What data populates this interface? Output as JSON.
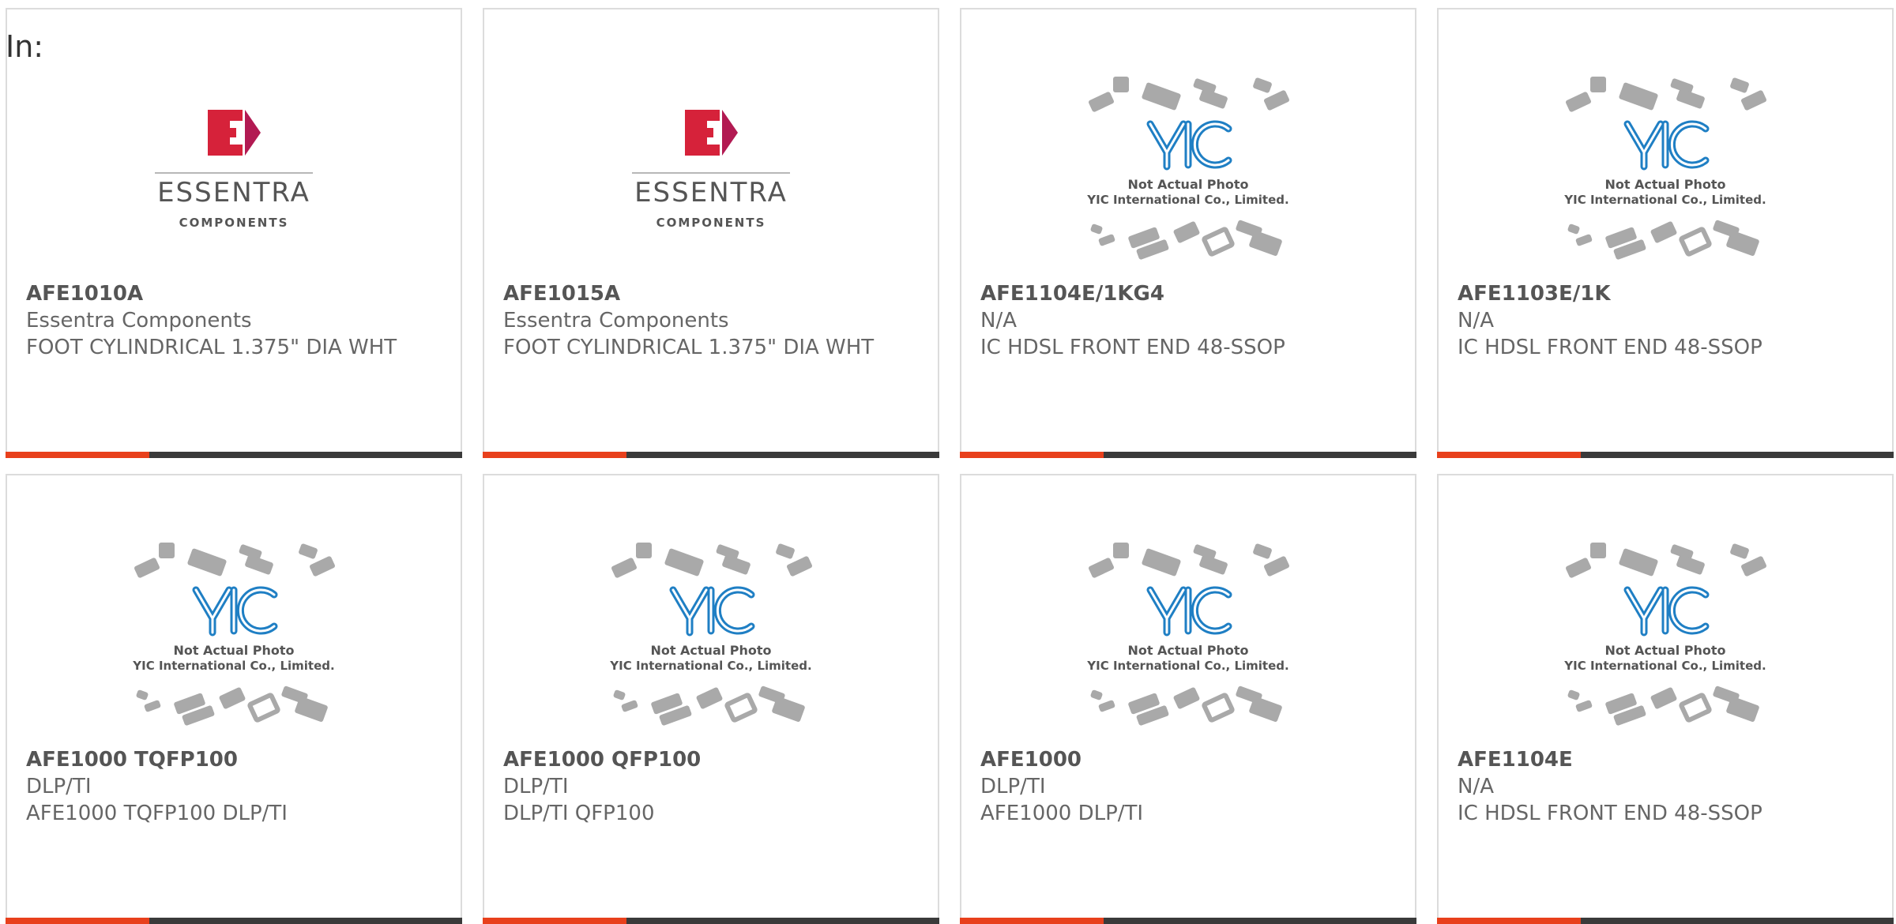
{
  "header": {
    "label": "In:"
  },
  "colors": {
    "accent": "#e8401c",
    "bar": "#3a3a3a",
    "border": "#dcdcdc",
    "essentra_red": "#d6223a",
    "yic_blue": "#1f7fc4"
  },
  "products": [
    {
      "part_number": "AFE1010A",
      "manufacturer": "Essentra Components",
      "description": "FOOT CYLINDRICAL 1.375\" DIA WHT",
      "image": "essentra-logo",
      "logo_text": "ESSENTRA",
      "logo_subtext": "COMPONENTS"
    },
    {
      "part_number": "AFE1015A",
      "manufacturer": "Essentra Components",
      "description": "FOOT CYLINDRICAL 1.375\" DIA WHT",
      "image": "essentra-logo",
      "logo_text": "ESSENTRA",
      "logo_subtext": "COMPONENTS"
    },
    {
      "part_number": "AFE1104E/1KG4",
      "manufacturer": "N/A",
      "description": "IC HDSL FRONT END 48-SSOP",
      "image": "yic-placeholder",
      "logo_text": "Not Actual Photo",
      "logo_subtext": "YIC International Co., Limited."
    },
    {
      "part_number": "AFE1103E/1K",
      "manufacturer": "N/A",
      "description": "IC HDSL FRONT END 48-SSOP",
      "image": "yic-placeholder",
      "logo_text": "Not Actual Photo",
      "logo_subtext": "YIC International Co., Limited."
    },
    {
      "part_number": "AFE1000 TQFP100",
      "manufacturer": "DLP/TI",
      "description": "AFE1000 TQFP100 DLP/TI",
      "image": "yic-placeholder",
      "logo_text": "Not Actual Photo",
      "logo_subtext": "YIC International Co., Limited."
    },
    {
      "part_number": "AFE1000 QFP100",
      "manufacturer": "DLP/TI",
      "description": "DLP/TI QFP100",
      "image": "yic-placeholder",
      "logo_text": "Not Actual Photo",
      "logo_subtext": "YIC International Co., Limited."
    },
    {
      "part_number": "AFE1000",
      "manufacturer": "DLP/TI",
      "description": "AFE1000 DLP/TI",
      "image": "yic-placeholder",
      "logo_text": "Not Actual Photo",
      "logo_subtext": "YIC International Co., Limited."
    },
    {
      "part_number": "AFE1104E",
      "manufacturer": "N/A",
      "description": "IC HDSL FRONT END 48-SSOP",
      "image": "yic-placeholder",
      "logo_text": "Not Actual Photo",
      "logo_subtext": "YIC International Co., Limited."
    }
  ]
}
